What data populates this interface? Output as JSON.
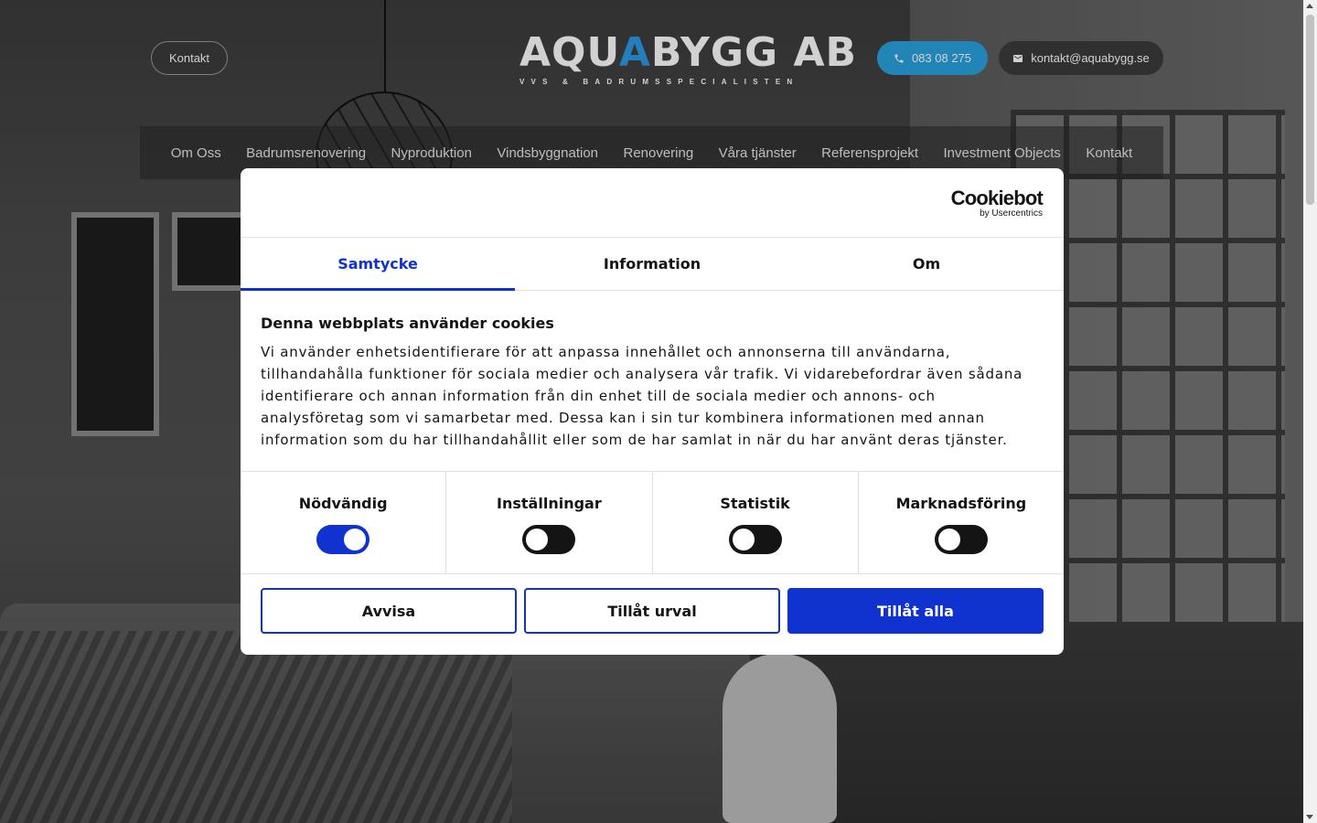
{
  "header": {
    "contact_label": "Kontakt",
    "logo": {
      "main_left": "AQU",
      "main_wave": "A",
      "main_right": "BYGG AB",
      "tagline": "VVS & BADRUMSSPECIALISTEN"
    },
    "phone_label": "083 08 275",
    "email_label": "kontakt@aquabygg.se"
  },
  "nav": {
    "items": [
      "Om Oss",
      "Badrumsrenovering",
      "Nyproduktion",
      "Vindsbyggnation",
      "Renovering",
      "Våra tjänster",
      "Referensprojekt",
      "Investment Objects",
      "Kontakt"
    ]
  },
  "cookie_dialog": {
    "brand": {
      "name": "Cookiebot",
      "sub": "by Usercentrics"
    },
    "tabs": [
      "Samtycke",
      "Information",
      "Om"
    ],
    "active_tab": "Samtycke",
    "title": "Denna webbplats använder cookies",
    "text": "Vi använder enhetsidentifierare för att anpassa innehållet och annonserna till användarna, tillhandahålla funktioner för sociala medier och analysera vår trafik. Vi vidarebefordrar även sådana identifierare och annan information från din enhet till de sociala medier och annons- och analysföretag som vi samarbetar med. Dessa kan i sin tur kombinera informationen med annan information som du har tillhandahållit eller som de har samlat in när du har använt deras tjänster.",
    "toggles": [
      {
        "label": "Nödvändig",
        "on": true
      },
      {
        "label": "Inställningar",
        "on": false
      },
      {
        "label": "Statistik",
        "on": false
      },
      {
        "label": "Marknadsföring",
        "on": false
      }
    ],
    "buttons": {
      "deny": "Avvisa",
      "allow_selection": "Tillåt urval",
      "allow_all": "Tillåt alla"
    }
  },
  "colors": {
    "accent": "#1032cf",
    "phone_button": "#2aa3e0",
    "logo_wave": "#2a9be6"
  }
}
